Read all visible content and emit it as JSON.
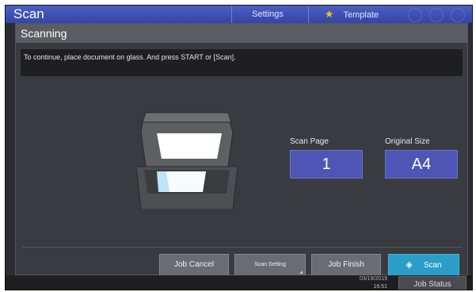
{
  "app": {
    "title": "Scan",
    "tabs": {
      "settings": "Settings",
      "template": "Template"
    }
  },
  "dialog": {
    "title": "Scanning",
    "message": "To continue, place document on glass. And press START or [Scan].",
    "fields": {
      "scan_page": {
        "label": "Scan Page",
        "value": "1"
      },
      "original_size": {
        "label": "Original Size",
        "value": "A4"
      }
    },
    "buttons": {
      "job_cancel": "Job Cancel",
      "scan_setting": "Scan Setting",
      "job_finish": "Job Finish",
      "scan": "Scan"
    }
  },
  "status_bar": {
    "date": "03/19/2019",
    "time": "16:51",
    "job_status": "Job Status"
  },
  "icons": {
    "template_star": "star-icon",
    "scan_start": "diamond-start-icon",
    "scanner": "scanner-illustration"
  }
}
